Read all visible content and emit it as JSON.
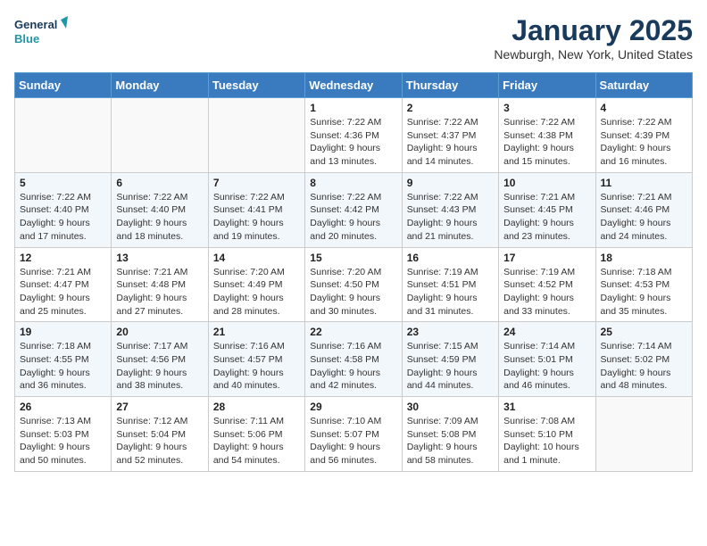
{
  "logo": {
    "line1": "General",
    "line2": "Blue"
  },
  "title": "January 2025",
  "location": "Newburgh, New York, United States",
  "days_of_week": [
    "Sunday",
    "Monday",
    "Tuesday",
    "Wednesday",
    "Thursday",
    "Friday",
    "Saturday"
  ],
  "weeks": [
    [
      {
        "day": "",
        "content": ""
      },
      {
        "day": "",
        "content": ""
      },
      {
        "day": "",
        "content": ""
      },
      {
        "day": "1",
        "content": "Sunrise: 7:22 AM\nSunset: 4:36 PM\nDaylight: 9 hours and 13 minutes."
      },
      {
        "day": "2",
        "content": "Sunrise: 7:22 AM\nSunset: 4:37 PM\nDaylight: 9 hours and 14 minutes."
      },
      {
        "day": "3",
        "content": "Sunrise: 7:22 AM\nSunset: 4:38 PM\nDaylight: 9 hours and 15 minutes."
      },
      {
        "day": "4",
        "content": "Sunrise: 7:22 AM\nSunset: 4:39 PM\nDaylight: 9 hours and 16 minutes."
      }
    ],
    [
      {
        "day": "5",
        "content": "Sunrise: 7:22 AM\nSunset: 4:40 PM\nDaylight: 9 hours and 17 minutes."
      },
      {
        "day": "6",
        "content": "Sunrise: 7:22 AM\nSunset: 4:40 PM\nDaylight: 9 hours and 18 minutes."
      },
      {
        "day": "7",
        "content": "Sunrise: 7:22 AM\nSunset: 4:41 PM\nDaylight: 9 hours and 19 minutes."
      },
      {
        "day": "8",
        "content": "Sunrise: 7:22 AM\nSunset: 4:42 PM\nDaylight: 9 hours and 20 minutes."
      },
      {
        "day": "9",
        "content": "Sunrise: 7:22 AM\nSunset: 4:43 PM\nDaylight: 9 hours and 21 minutes."
      },
      {
        "day": "10",
        "content": "Sunrise: 7:21 AM\nSunset: 4:45 PM\nDaylight: 9 hours and 23 minutes."
      },
      {
        "day": "11",
        "content": "Sunrise: 7:21 AM\nSunset: 4:46 PM\nDaylight: 9 hours and 24 minutes."
      }
    ],
    [
      {
        "day": "12",
        "content": "Sunrise: 7:21 AM\nSunset: 4:47 PM\nDaylight: 9 hours and 25 minutes."
      },
      {
        "day": "13",
        "content": "Sunrise: 7:21 AM\nSunset: 4:48 PM\nDaylight: 9 hours and 27 minutes."
      },
      {
        "day": "14",
        "content": "Sunrise: 7:20 AM\nSunset: 4:49 PM\nDaylight: 9 hours and 28 minutes."
      },
      {
        "day": "15",
        "content": "Sunrise: 7:20 AM\nSunset: 4:50 PM\nDaylight: 9 hours and 30 minutes."
      },
      {
        "day": "16",
        "content": "Sunrise: 7:19 AM\nSunset: 4:51 PM\nDaylight: 9 hours and 31 minutes."
      },
      {
        "day": "17",
        "content": "Sunrise: 7:19 AM\nSunset: 4:52 PM\nDaylight: 9 hours and 33 minutes."
      },
      {
        "day": "18",
        "content": "Sunrise: 7:18 AM\nSunset: 4:53 PM\nDaylight: 9 hours and 35 minutes."
      }
    ],
    [
      {
        "day": "19",
        "content": "Sunrise: 7:18 AM\nSunset: 4:55 PM\nDaylight: 9 hours and 36 minutes."
      },
      {
        "day": "20",
        "content": "Sunrise: 7:17 AM\nSunset: 4:56 PM\nDaylight: 9 hours and 38 minutes."
      },
      {
        "day": "21",
        "content": "Sunrise: 7:16 AM\nSunset: 4:57 PM\nDaylight: 9 hours and 40 minutes."
      },
      {
        "day": "22",
        "content": "Sunrise: 7:16 AM\nSunset: 4:58 PM\nDaylight: 9 hours and 42 minutes."
      },
      {
        "day": "23",
        "content": "Sunrise: 7:15 AM\nSunset: 4:59 PM\nDaylight: 9 hours and 44 minutes."
      },
      {
        "day": "24",
        "content": "Sunrise: 7:14 AM\nSunset: 5:01 PM\nDaylight: 9 hours and 46 minutes."
      },
      {
        "day": "25",
        "content": "Sunrise: 7:14 AM\nSunset: 5:02 PM\nDaylight: 9 hours and 48 minutes."
      }
    ],
    [
      {
        "day": "26",
        "content": "Sunrise: 7:13 AM\nSunset: 5:03 PM\nDaylight: 9 hours and 50 minutes."
      },
      {
        "day": "27",
        "content": "Sunrise: 7:12 AM\nSunset: 5:04 PM\nDaylight: 9 hours and 52 minutes."
      },
      {
        "day": "28",
        "content": "Sunrise: 7:11 AM\nSunset: 5:06 PM\nDaylight: 9 hours and 54 minutes."
      },
      {
        "day": "29",
        "content": "Sunrise: 7:10 AM\nSunset: 5:07 PM\nDaylight: 9 hours and 56 minutes."
      },
      {
        "day": "30",
        "content": "Sunrise: 7:09 AM\nSunset: 5:08 PM\nDaylight: 9 hours and 58 minutes."
      },
      {
        "day": "31",
        "content": "Sunrise: 7:08 AM\nSunset: 5:10 PM\nDaylight: 10 hours and 1 minute."
      },
      {
        "day": "",
        "content": ""
      }
    ]
  ]
}
